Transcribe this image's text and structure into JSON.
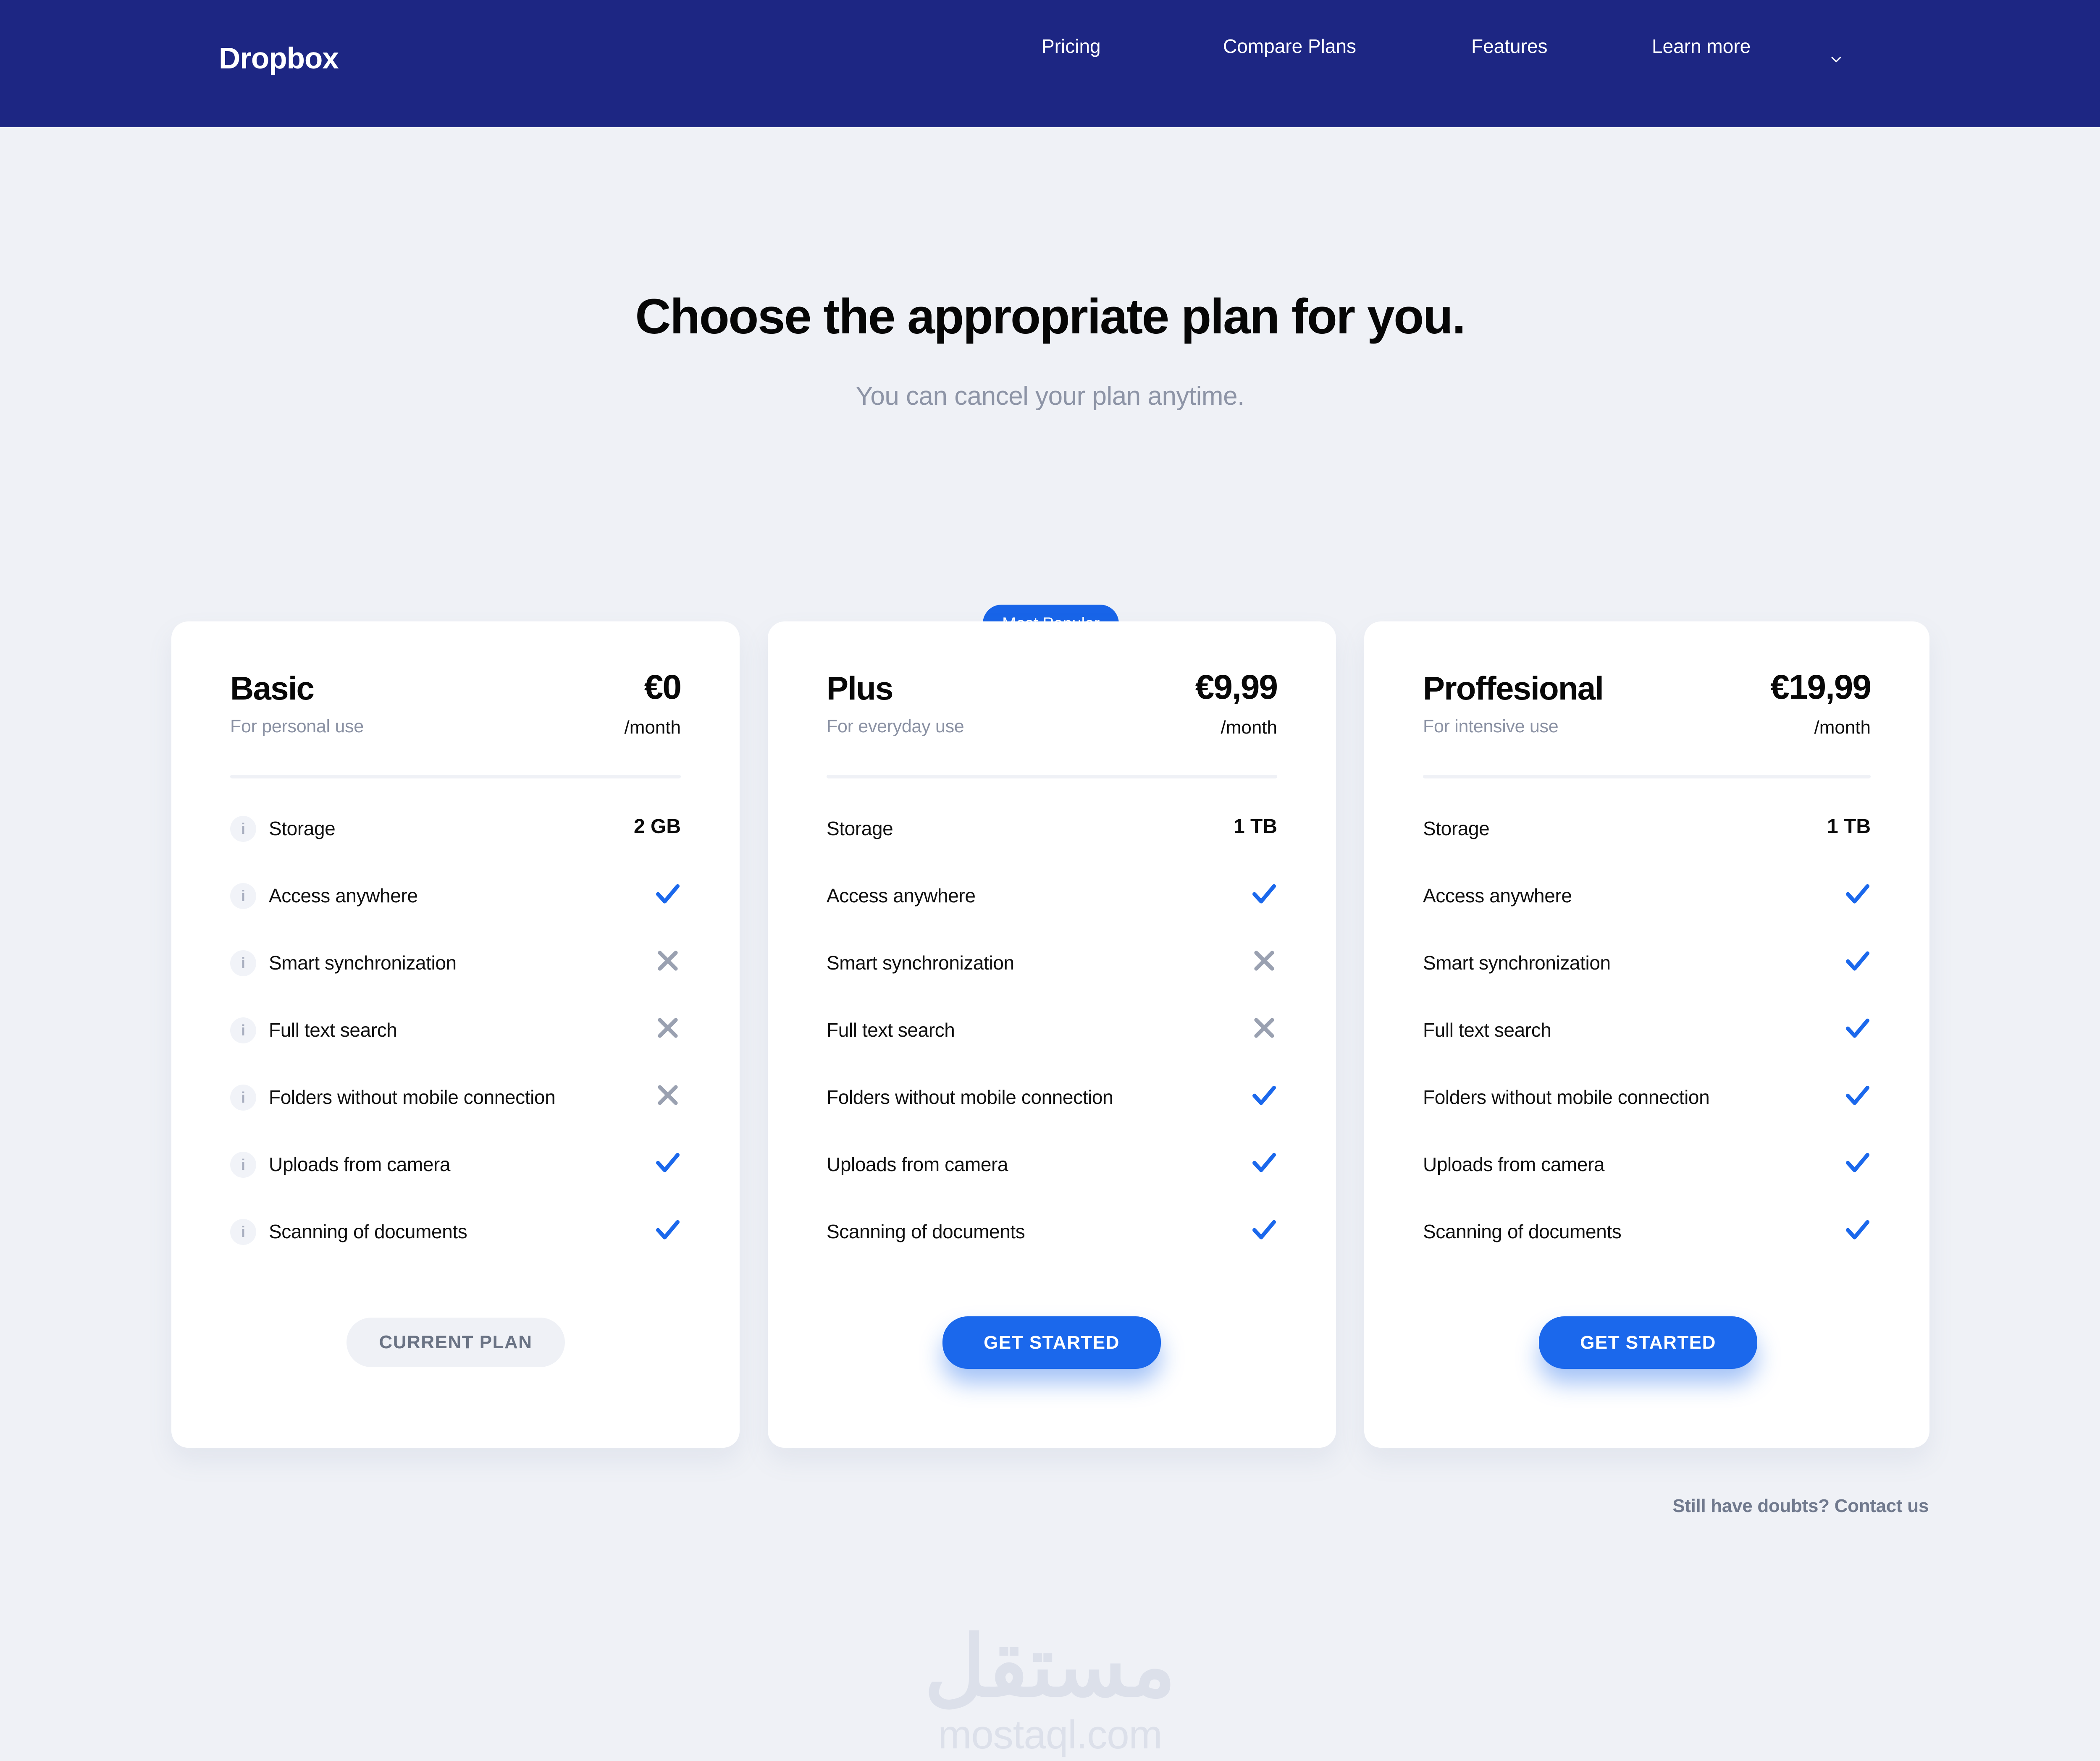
{
  "nav": {
    "brand": "Dropbox",
    "links": [
      {
        "label": "Pricing"
      },
      {
        "label": "Compare Plans"
      },
      {
        "label": "Features"
      },
      {
        "label": "Learn more"
      }
    ],
    "dropdown_icon": "chevron-down-icon"
  },
  "hero": {
    "title": "Choose the appropriate plan for you.",
    "subtitle": "You can cancel your plan anytime."
  },
  "badge": {
    "label": "Most Popular"
  },
  "plans": [
    {
      "name": "Basic",
      "description": "For personal use",
      "price": "€0",
      "period": "/month",
      "has_info_icons": true,
      "button": {
        "label": "CURRENT PLAN",
        "style": "muted"
      },
      "features": [
        {
          "label": "Storage",
          "value": "2 GB",
          "type": "text"
        },
        {
          "label": "Access anywhere",
          "value": "check",
          "type": "icon"
        },
        {
          "label": "Smart synchronization",
          "value": "cross",
          "type": "icon"
        },
        {
          "label": "Full text search",
          "value": "cross",
          "type": "icon"
        },
        {
          "label": "Folders without mobile connection",
          "value": "cross",
          "type": "icon"
        },
        {
          "label": "Uploads from camera",
          "value": "check",
          "type": "icon"
        },
        {
          "label": "Scanning of documents",
          "value": "check",
          "type": "icon"
        }
      ]
    },
    {
      "name": "Plus",
      "description": "For everyday use",
      "price": "€9,99",
      "period": "/month",
      "has_info_icons": false,
      "button": {
        "label": "GET STARTED",
        "style": "primary"
      },
      "features": [
        {
          "label": "Storage",
          "value": "1 TB",
          "type": "text"
        },
        {
          "label": "Access anywhere",
          "value": "check",
          "type": "icon"
        },
        {
          "label": "Smart synchronization",
          "value": "cross",
          "type": "icon"
        },
        {
          "label": "Full text search",
          "value": "cross",
          "type": "icon"
        },
        {
          "label": "Folders without mobile connection",
          "value": "check",
          "type": "icon"
        },
        {
          "label": "Uploads from camera",
          "value": "check",
          "type": "icon"
        },
        {
          "label": "Scanning of documents",
          "value": "check",
          "type": "icon"
        }
      ]
    },
    {
      "name": "Proffesional",
      "description": "For intensive use",
      "price": "€19,99",
      "period": "/month",
      "has_info_icons": false,
      "button": {
        "label": "GET STARTED",
        "style": "primary"
      },
      "features": [
        {
          "label": "Storage",
          "value": "1 TB",
          "type": "text"
        },
        {
          "label": "Access anywhere",
          "value": "check",
          "type": "icon"
        },
        {
          "label": "Smart synchronization",
          "value": "check",
          "type": "icon"
        },
        {
          "label": "Full text search",
          "value": "check",
          "type": "icon"
        },
        {
          "label": "Folders without mobile connection",
          "value": "check",
          "type": "icon"
        },
        {
          "label": "Uploads from camera",
          "value": "check",
          "type": "icon"
        },
        {
          "label": "Scanning of documents",
          "value": "check",
          "type": "icon"
        }
      ]
    }
  ],
  "footer": {
    "contact": "Still have doubts? Contact us"
  },
  "watermark": {
    "arabic": "مستقل",
    "latin": "mostaql.com"
  },
  "colors": {
    "nav_bg": "#1d2683",
    "page_bg": "#eff1f6",
    "accent_blue": "#1b68ec",
    "badge_blue": "#1864e8",
    "check_blue": "#1b68ec",
    "cross_gray": "#9aa1b1",
    "muted_text": "#8d94a6"
  },
  "info_icon_label": "i"
}
